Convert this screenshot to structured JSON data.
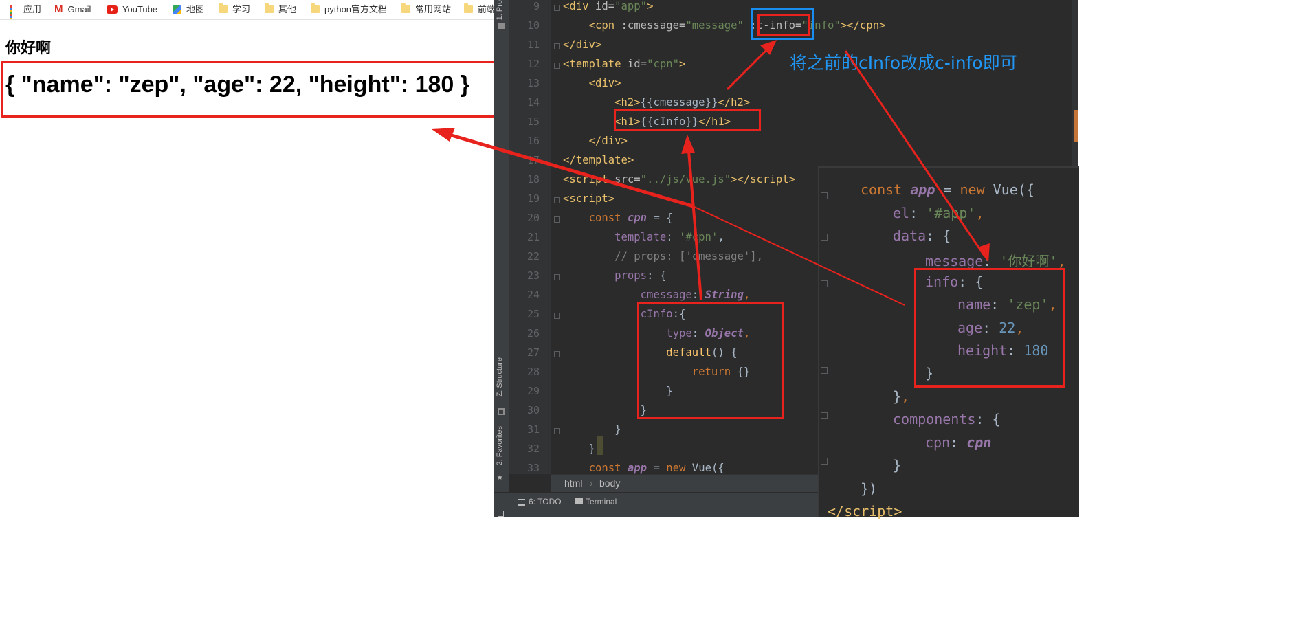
{
  "browser": {
    "bookmarks": [
      {
        "label": "应用",
        "icon": "apps-grid-icon"
      },
      {
        "label": "Gmail",
        "icon": "gmail-icon"
      },
      {
        "label": "YouTube",
        "icon": "youtube-icon"
      },
      {
        "label": "地图",
        "icon": "maps-icon"
      },
      {
        "label": "学习",
        "icon": "folder-icon"
      },
      {
        "label": "其他",
        "icon": "folder-icon"
      },
      {
        "label": "python官方文档",
        "icon": "folder-icon"
      },
      {
        "label": "常用网站",
        "icon": "folder-icon"
      },
      {
        "label": "前端",
        "icon": "folder-icon"
      }
    ],
    "h2_text": "你好啊",
    "h1_text": "{ \"name\": \"zep\", \"age\": 22, \"height\": 180 }"
  },
  "ide": {
    "side_tabs": {
      "project": "1: Pro",
      "structure": "Z: Structure",
      "favorites": "2: Favorites"
    },
    "line_numbers": [
      "9",
      "10",
      "11",
      "12",
      "13",
      "14",
      "15",
      "16",
      "17",
      "18",
      "19",
      "20",
      "21",
      "22",
      "23",
      "24",
      "25",
      "26",
      "27",
      "28",
      "29",
      "30",
      "31",
      "32",
      "33"
    ],
    "breadcrumbs": [
      "html",
      "body"
    ],
    "status_tabs": {
      "todo": "6: TODO",
      "terminal": "Terminal"
    },
    "annotation": "将之前的cInfo改成c-info即可"
  },
  "colors": {
    "highlight_red": "#e8221c",
    "highlight_blue": "#1a8ef0",
    "annotation_blue": "#2196f3",
    "editor_bg": "#2b2b2b"
  }
}
